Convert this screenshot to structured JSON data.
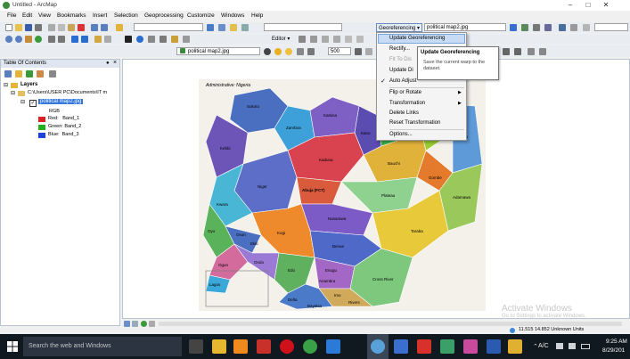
{
  "window": {
    "title": "Untitled - ArcMap"
  },
  "menu": [
    "File",
    "Edit",
    "View",
    "Bookmarks",
    "Insert",
    "Selection",
    "Geoprocessing",
    "Customize",
    "Windows",
    "Help"
  ],
  "toolbar": {
    "editor_label": "Editor ▾",
    "layer_combo": "political map2.jpg",
    "scale_value": "500",
    "georef_button": "Georeferencing ▾",
    "georef_layer": "political map2.jpg"
  },
  "georef_menu": {
    "items": [
      {
        "label": "Update Georeferencing",
        "state": "highlighted"
      },
      {
        "label": "Rectify...",
        "state": "normal"
      },
      {
        "label": "Fit To Dis",
        "state": "disabled"
      },
      {
        "label": "Update Di",
        "state": "normal"
      },
      {
        "label": "Auto Adjust",
        "state": "checked"
      },
      {
        "label": "Flip or Rotate",
        "state": "submenu"
      },
      {
        "label": "Transformation",
        "state": "submenu"
      },
      {
        "label": "Delete Links",
        "state": "normal"
      },
      {
        "label": "Reset Transformation",
        "state": "normal"
      },
      {
        "label": "Options...",
        "state": "normal"
      }
    ]
  },
  "tooltip": {
    "title": "Update Georeferencing",
    "text": "Save the current warp to the dataset."
  },
  "toc": {
    "title": "Table Of Contents",
    "layers_label": "Layers",
    "path_label": "C:\\Users\\USER PC\\Documents\\IT m",
    "raster_label": "political map2.jpg",
    "rgb_label": "RGB",
    "bands": [
      {
        "name": "Red:   Band_1",
        "color": "#e02020"
      },
      {
        "name": "Green: Band_2",
        "color": "#20b020"
      },
      {
        "name": "Blue:  Band_3",
        "color": "#2040e0"
      }
    ]
  },
  "map": {
    "heading": "Administrative: Nigeria",
    "regions": [
      "Sokoto",
      "Katsina",
      "Zamfara",
      "Kano",
      "Jigawa",
      "Yobe",
      "Borno",
      "Kebbi",
      "Kaduna",
      "Bauchi",
      "Gombe",
      "Adamawa",
      "Niger",
      "Plateau",
      "Kwara",
      "Abuja (FCT)",
      "Nasarawa",
      "Taraba",
      "Benue",
      "Kogi",
      "Oyo",
      "Ogun",
      "Osun",
      "Ekiti",
      "Ondo",
      "Edo",
      "Lagos",
      "Enugu",
      "Anambra",
      "Imo",
      "Cross River",
      "Rivers",
      "Delta",
      "Bayelsa"
    ]
  },
  "watermark": {
    "line1": "Activate Windows",
    "line2": "Go to Settings to activate Windows."
  },
  "status": {
    "coords": "11.515  14.852 Unknown Units"
  },
  "taskbar": {
    "search_placeholder": "Search the web and Windows",
    "time": "9:25 AM",
    "date": "8/29/201",
    "keyboard": "A/C"
  }
}
